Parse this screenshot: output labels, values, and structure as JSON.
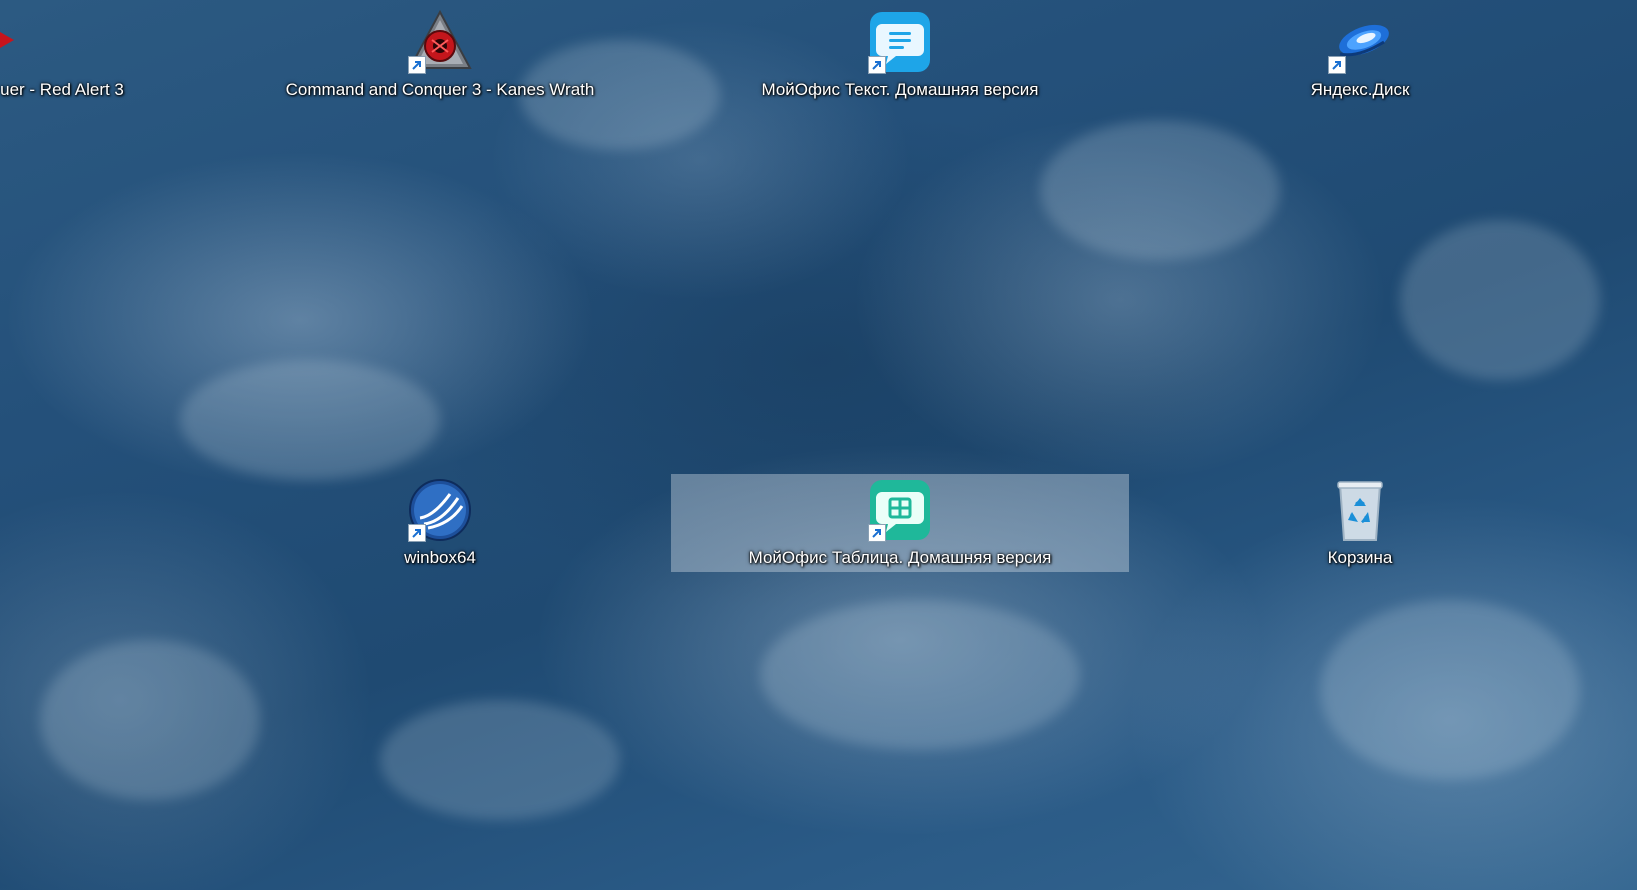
{
  "desktop": {
    "icons": [
      {
        "label": "uer - Red Alert 3",
        "icon": "red-alert-3-icon",
        "shortcut": true
      },
      {
        "label": "Command and Conquer 3 - Kanes Wrath",
        "icon": "kanes-wrath-icon",
        "shortcut": true
      },
      {
        "label": "МойОфис Текст. Домашняя версия",
        "icon": "myoffice-text-icon",
        "shortcut": true
      },
      {
        "label": "Яндекс.Диск",
        "icon": "yandex-disk-icon",
        "shortcut": true
      },
      {
        "label": "winbox64",
        "icon": "winbox-icon",
        "shortcut": true
      },
      {
        "label": "МойОфис Таблица. Домашняя версия",
        "icon": "myoffice-table-icon",
        "shortcut": true,
        "selected": true
      },
      {
        "label": "Корзина",
        "icon": "recycle-bin-icon",
        "shortcut": false
      }
    ]
  },
  "colors": {
    "label_text": "#ffffff",
    "selection": "#dce4ec",
    "myoffice_text_accent": "#1ea5e8",
    "myoffice_table_accent": "#1fb89a",
    "kanes_wrath_accent": "#c4161c",
    "yandex_disk_accent": "#1e6fd9"
  }
}
